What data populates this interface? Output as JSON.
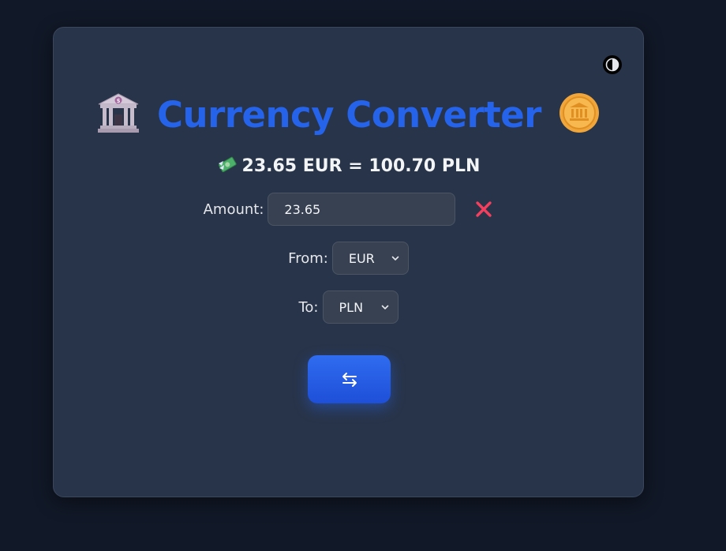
{
  "app": {
    "title": "Currency Converter",
    "title_icons": [
      "bank-icon",
      "coin-icon"
    ],
    "accent_color": "#2563eb"
  },
  "theme_toggle": {
    "icon": "contrast-icon"
  },
  "result": {
    "icon": "money-with-wings-icon",
    "text": "23.65 EUR = 100.70 PLN"
  },
  "form": {
    "amount": {
      "label": "Amount:",
      "value": "23.65",
      "clear_icon": "close-icon"
    },
    "from": {
      "label": "From:",
      "selected": "EUR"
    },
    "to": {
      "label": "To:",
      "selected": "PLN"
    }
  },
  "swap_button": {
    "icon": "swap-arrows-icon"
  }
}
